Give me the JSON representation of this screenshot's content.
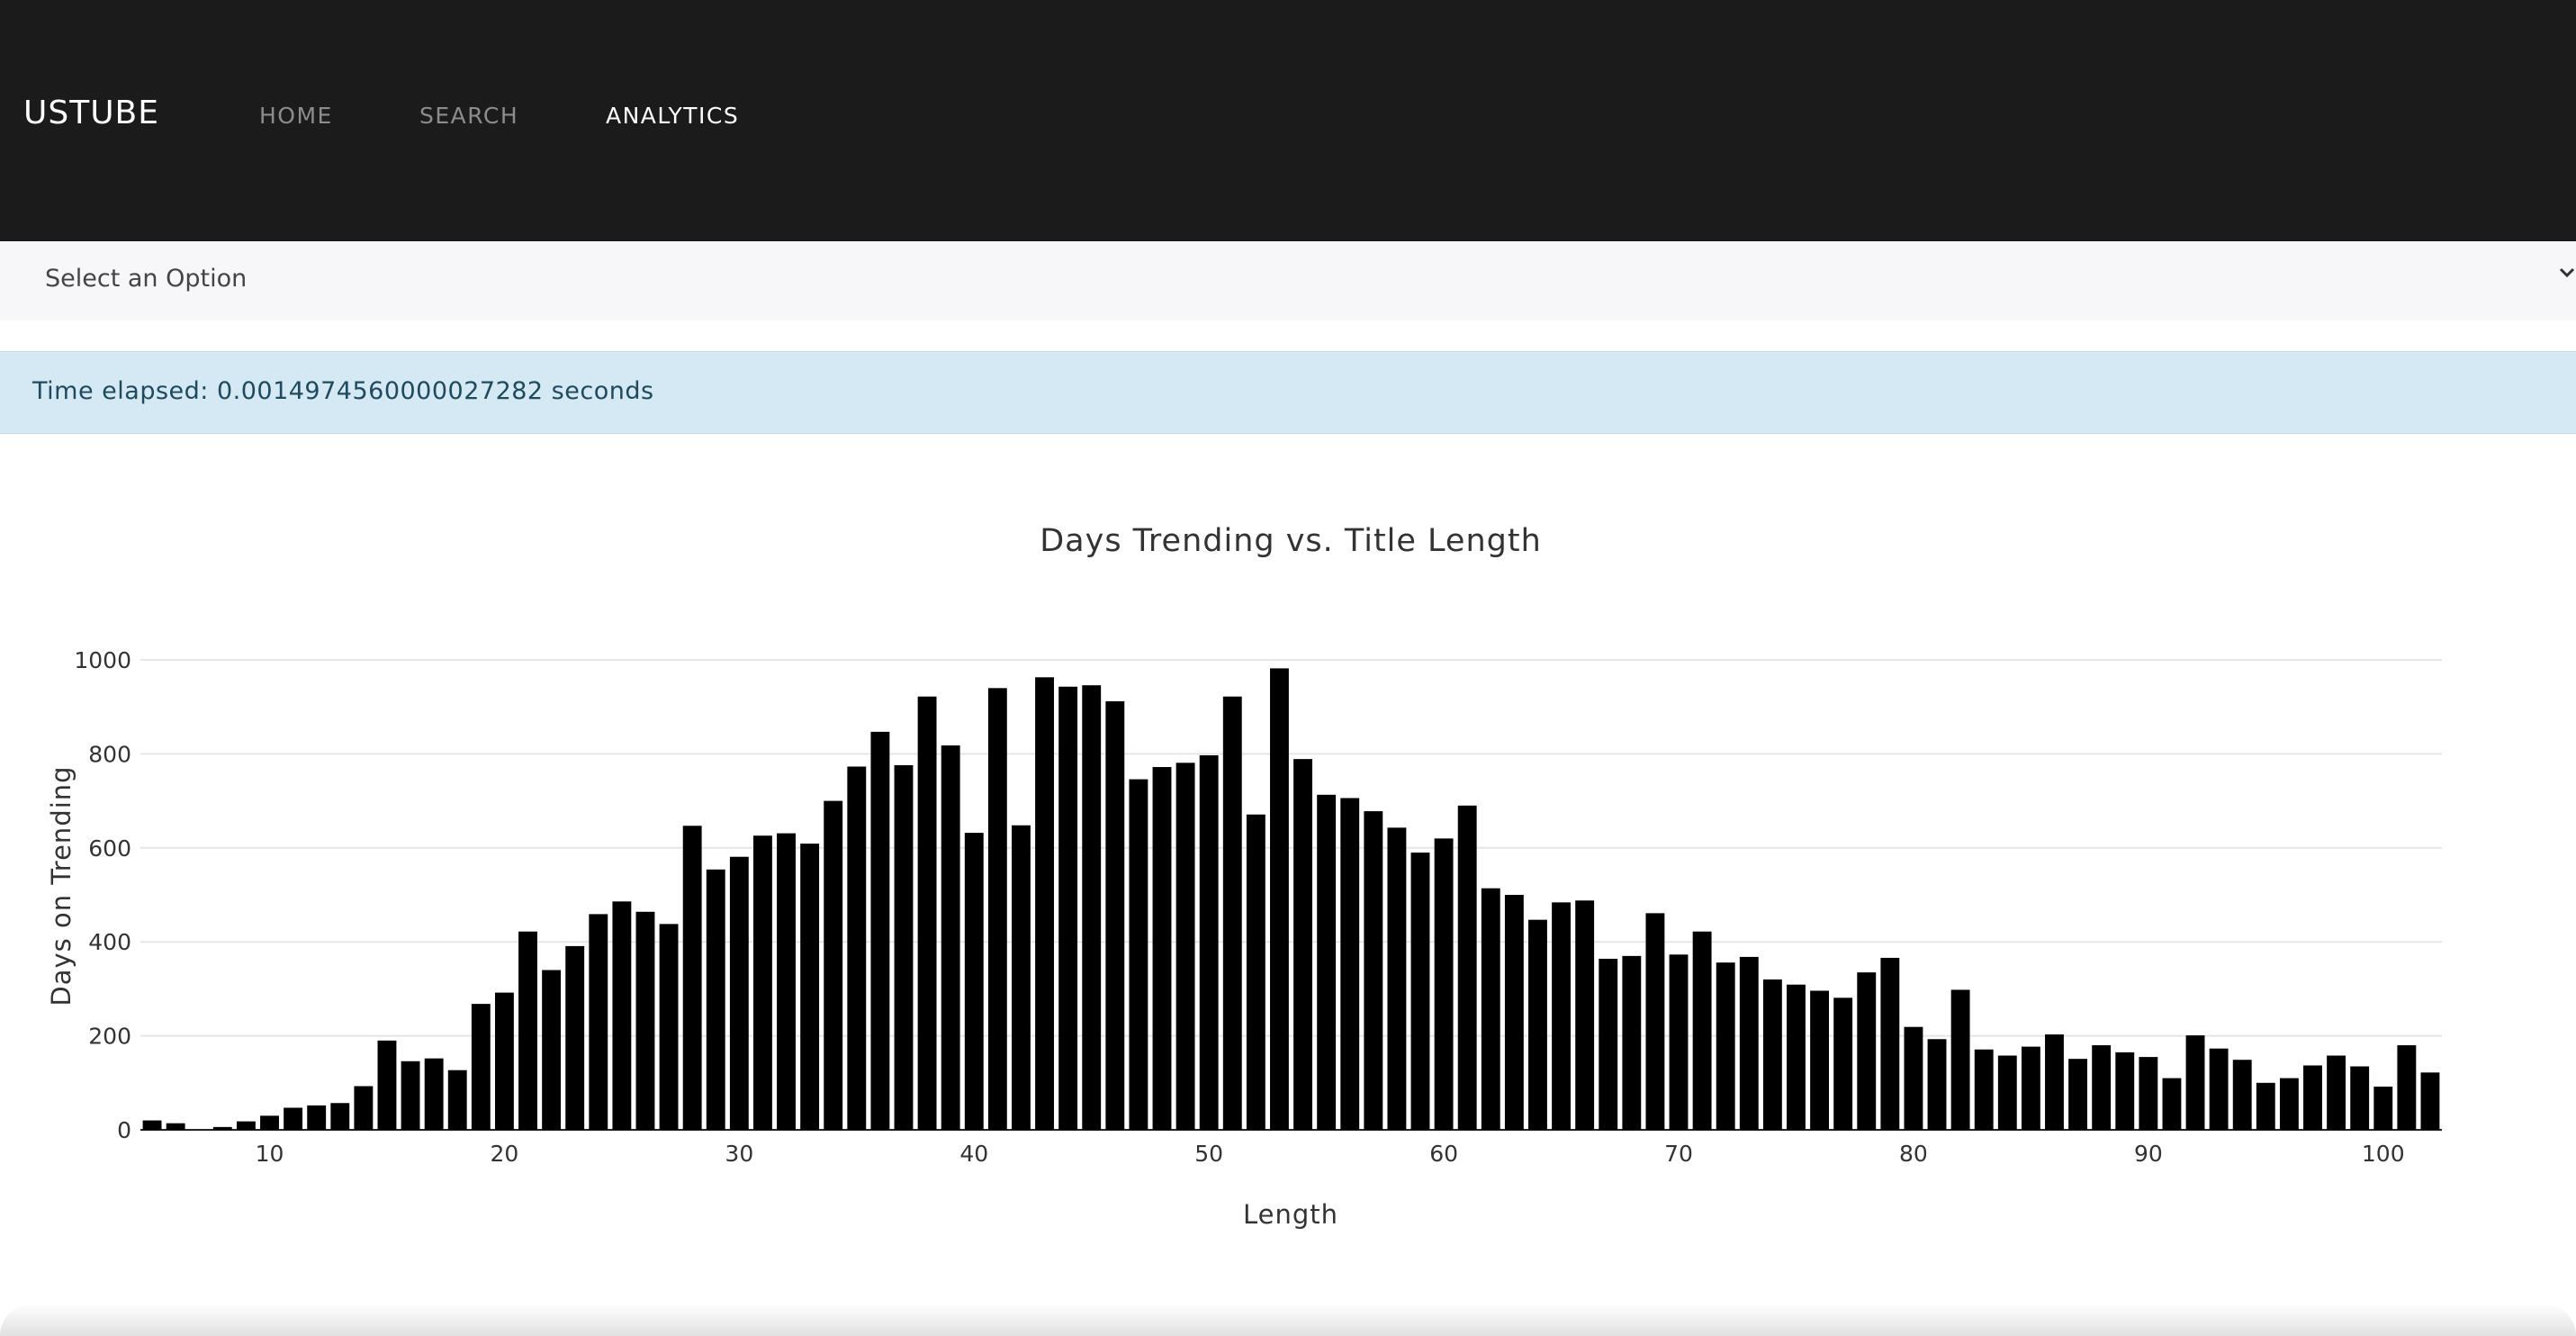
{
  "navbar": {
    "brand": "USTUBE",
    "links": [
      {
        "label": "HOME",
        "active": false
      },
      {
        "label": "SEARCH",
        "active": false
      },
      {
        "label": "ANALYTICS",
        "active": true
      }
    ]
  },
  "select": {
    "value": "Select an Option"
  },
  "alert": {
    "text": "Time elapsed: 0.0014974560000027282 seconds"
  },
  "colors": {
    "navbar_bg": "#1b1b1b",
    "alert_bg": "#d4e9f3",
    "bar": "#000000"
  },
  "chart_data": {
    "type": "bar",
    "title": "Days Trending vs. Title Length",
    "xlabel": "Length",
    "ylabel": "Days on Trending",
    "xlim": [
      4.5,
      102.5
    ],
    "ylim": [
      0,
      1000
    ],
    "xticks": [
      10,
      20,
      30,
      40,
      50,
      60,
      70,
      80,
      90,
      100
    ],
    "yticks": [
      0,
      200,
      400,
      600,
      800,
      1000
    ],
    "grid": true,
    "x": [
      5,
      6,
      7,
      8,
      9,
      10,
      11,
      12,
      13,
      14,
      15,
      16,
      17,
      18,
      19,
      20,
      21,
      22,
      23,
      24,
      25,
      26,
      27,
      28,
      29,
      30,
      31,
      32,
      33,
      34,
      35,
      36,
      37,
      38,
      39,
      40,
      41,
      42,
      43,
      44,
      45,
      46,
      47,
      48,
      49,
      50,
      51,
      52,
      53,
      54,
      55,
      56,
      57,
      58,
      59,
      60,
      61,
      62,
      63,
      64,
      65,
      66,
      67,
      68,
      69,
      70,
      71,
      72,
      73,
      74,
      75,
      76,
      77,
      78,
      79,
      80,
      81,
      82,
      83,
      84,
      85,
      86,
      87,
      88,
      89,
      90,
      91,
      92,
      93,
      94,
      95,
      96,
      97,
      98,
      99,
      100,
      101,
      102
    ],
    "values": [
      20,
      14,
      0,
      6,
      18,
      30,
      47,
      52,
      57,
      93,
      190,
      146,
      152,
      127,
      268,
      292,
      422,
      340,
      391,
      459,
      486,
      464,
      438,
      647,
      554,
      581,
      626,
      631,
      609,
      700,
      773,
      847,
      776,
      922,
      818,
      632,
      940,
      648,
      963,
      943,
      946,
      912,
      746,
      772,
      781,
      797,
      922,
      671,
      982,
      789,
      713,
      706,
      678,
      643,
      590,
      620,
      690,
      514,
      500,
      447,
      484,
      488,
      364,
      370,
      461,
      373,
      422,
      356,
      368,
      320,
      309,
      296,
      281,
      335,
      366,
      219,
      193,
      298,
      171,
      158,
      177,
      203,
      151,
      180,
      165,
      155,
      110,
      201,
      173,
      149,
      100,
      110,
      137,
      158,
      135,
      92,
      180,
      122
    ]
  }
}
